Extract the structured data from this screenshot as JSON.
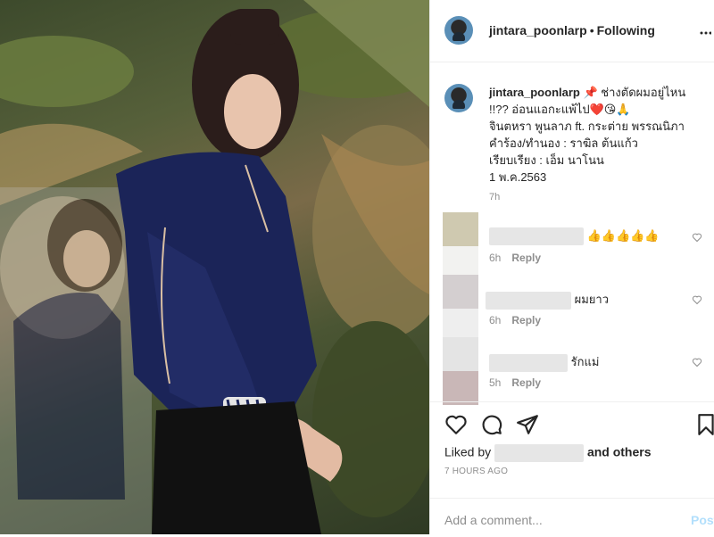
{
  "header": {
    "username": "jintara_poonlarp",
    "separator": "•",
    "follow_state": "Following"
  },
  "caption": {
    "username": "jintara_poonlarp",
    "pin_emoji": "📌",
    "line1": "ช่างตัดผมอยู่ไหน",
    "line2": "!!?? อ่อนแอกะแพ้ไป",
    "emojis_line2": "❤️😘🙏",
    "line3": "จินตหรา พูนลาภ ft. กระต่าย พรรณนิภา",
    "line4": "คำร้อง/ทำนอง : ราฆิล ต้นแก้ว",
    "line5": "เรียบเรียง : เอ็ม นาโนน",
    "line6": "1 พ.ค.2563",
    "time": "7h"
  },
  "comments": [
    {
      "text": "👍👍👍👍👍",
      "time": "6h",
      "reply": "Reply"
    },
    {
      "text": "ผมยาว",
      "time": "6h",
      "reply": "Reply"
    },
    {
      "text": "รักแม่",
      "time": "5h",
      "reply": "Reply"
    }
  ],
  "likes": {
    "prefix": "Liked by",
    "suffix": "and others",
    "timestamp": "7 HOURS AGO"
  },
  "add_comment": {
    "placeholder": "Add a comment...",
    "post_label": "Post"
  },
  "colors": {
    "accent_post": "#b2dffc",
    "meta_gray": "#8e8e8e",
    "heart_red": "#ed4956"
  }
}
